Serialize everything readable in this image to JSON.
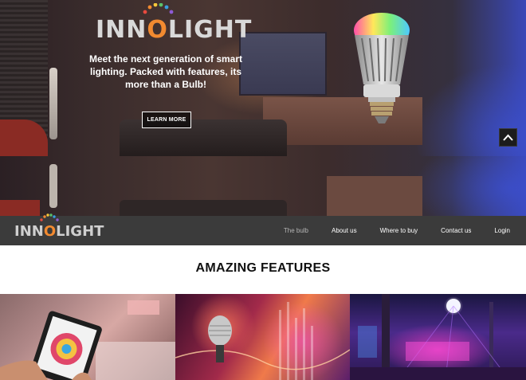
{
  "brand": {
    "name_before_o": "INN",
    "name_after_o": "LIGHT",
    "letter_o": "O",
    "logo_colors": [
      "#e94a3f",
      "#f28a30",
      "#f6c83b",
      "#5cc26a",
      "#3a9ee0",
      "#8e5ad6"
    ]
  },
  "hero": {
    "tagline": "Meet the next generation of smart lighting. Packed with features, its more than a Bulb!",
    "cta_label": "LEARN MORE"
  },
  "nav": {
    "items": [
      {
        "label": "The bulb",
        "active": true
      },
      {
        "label": "About us",
        "active": false
      },
      {
        "label": "Where to buy",
        "active": false
      },
      {
        "label": "Contact us",
        "active": false
      },
      {
        "label": "Login",
        "active": false
      }
    ]
  },
  "features": {
    "title": "AMAZING FEATURES"
  },
  "colors": {
    "nav_background": "#3b3b3b",
    "nav_active_text": "#b5b5b5",
    "accent_orange": "#f28a30"
  }
}
